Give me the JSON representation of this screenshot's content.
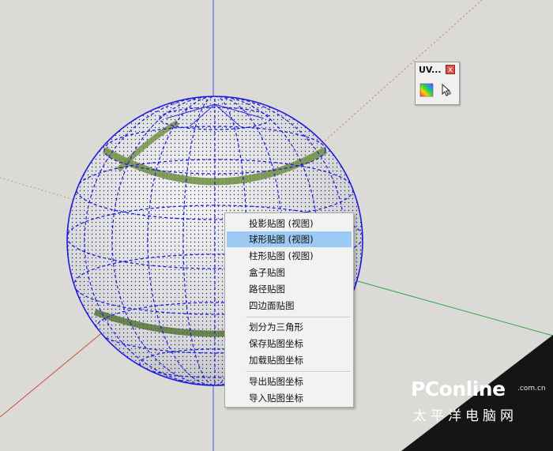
{
  "toolbar": {
    "title": "UV...",
    "close_label": "x",
    "colors": {
      "close": "#d9534f"
    }
  },
  "context_menu": {
    "items": [
      {
        "label": "投影贴图 (视图)",
        "selected": false
      },
      {
        "label": "球形贴图 (视图)",
        "selected": true
      },
      {
        "label": "柱形贴图 (视图)",
        "selected": false
      },
      {
        "label": "盒子贴图",
        "selected": false
      },
      {
        "label": "路径贴图",
        "selected": false
      },
      {
        "label": "四边面贴图",
        "selected": false
      },
      {
        "label": "划分为三角形",
        "selected": false
      },
      {
        "label": "保存贴图坐标",
        "selected": false
      },
      {
        "label": "加载贴图坐标",
        "selected": false
      },
      {
        "label": "导出贴图坐标",
        "selected": false
      },
      {
        "label": "导入贴图坐标",
        "selected": false
      }
    ],
    "colors": {
      "highlight": "#9ccaf5"
    }
  },
  "watermark": {
    "brand": "PConline",
    "domain": ".com.cn",
    "chinese": "太平洋电脑网"
  },
  "scene": {
    "colors": {
      "background": "#dcdad6",
      "wireframe": "#1c1ce0",
      "sphere_fill": "#d9d9dc",
      "texture_band": "#6f8f3f",
      "axis_blue": "#3b5bd9",
      "axis_red": "#d04a3a",
      "axis_green": "#2fa84a"
    }
  }
}
